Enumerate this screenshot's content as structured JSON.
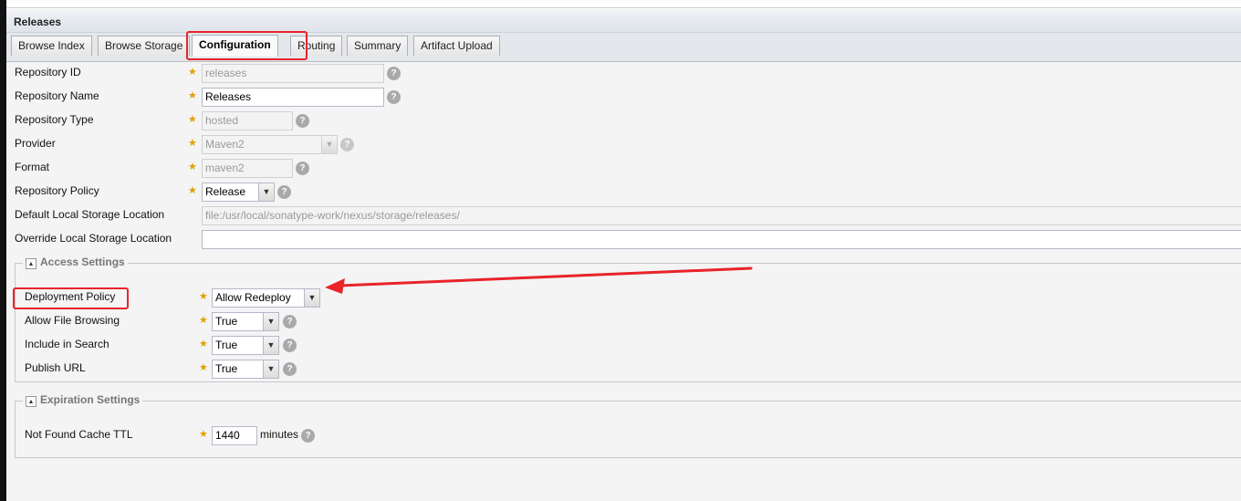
{
  "panel": {
    "title": "Releases"
  },
  "tabs": [
    {
      "label": "Browse Index"
    },
    {
      "label": "Browse Storage"
    },
    {
      "label": "Configuration"
    },
    {
      "label": "Routing"
    },
    {
      "label": "Summary"
    },
    {
      "label": "Artifact Upload"
    }
  ],
  "fields": {
    "repo_id": {
      "label": "Repository ID",
      "value": "releases"
    },
    "repo_name": {
      "label": "Repository Name",
      "value": "Releases"
    },
    "repo_type": {
      "label": "Repository Type",
      "value": "hosted"
    },
    "provider": {
      "label": "Provider",
      "value": "Maven2"
    },
    "format": {
      "label": "Format",
      "value": "maven2"
    },
    "repo_policy": {
      "label": "Repository Policy",
      "value": "Release"
    },
    "default_storage": {
      "label": "Default Local Storage Location",
      "value": "file:/usr/local/sonatype-work/nexus/storage/releases/"
    },
    "override_storage": {
      "label": "Override Local Storage Location",
      "value": ""
    }
  },
  "access": {
    "legend": "Access Settings",
    "deployment_policy": {
      "label": "Deployment Policy",
      "value": "Allow Redeploy"
    },
    "file_browsing": {
      "label": "Allow File Browsing",
      "value": "True"
    },
    "include_search": {
      "label": "Include in Search",
      "value": "True"
    },
    "publish_url": {
      "label": "Publish URL",
      "value": "True"
    }
  },
  "expiration": {
    "legend": "Expiration Settings",
    "not_found_ttl": {
      "label": "Not Found Cache TTL",
      "value": "1440",
      "unit": "minutes"
    }
  },
  "icons": {
    "required": "star-icon",
    "help": "help-icon",
    "dropdown": "chevron-down-icon",
    "collapse": "collapse-icon"
  },
  "colors": {
    "annotation": "#e8232a",
    "required_star": "#e0a000"
  }
}
